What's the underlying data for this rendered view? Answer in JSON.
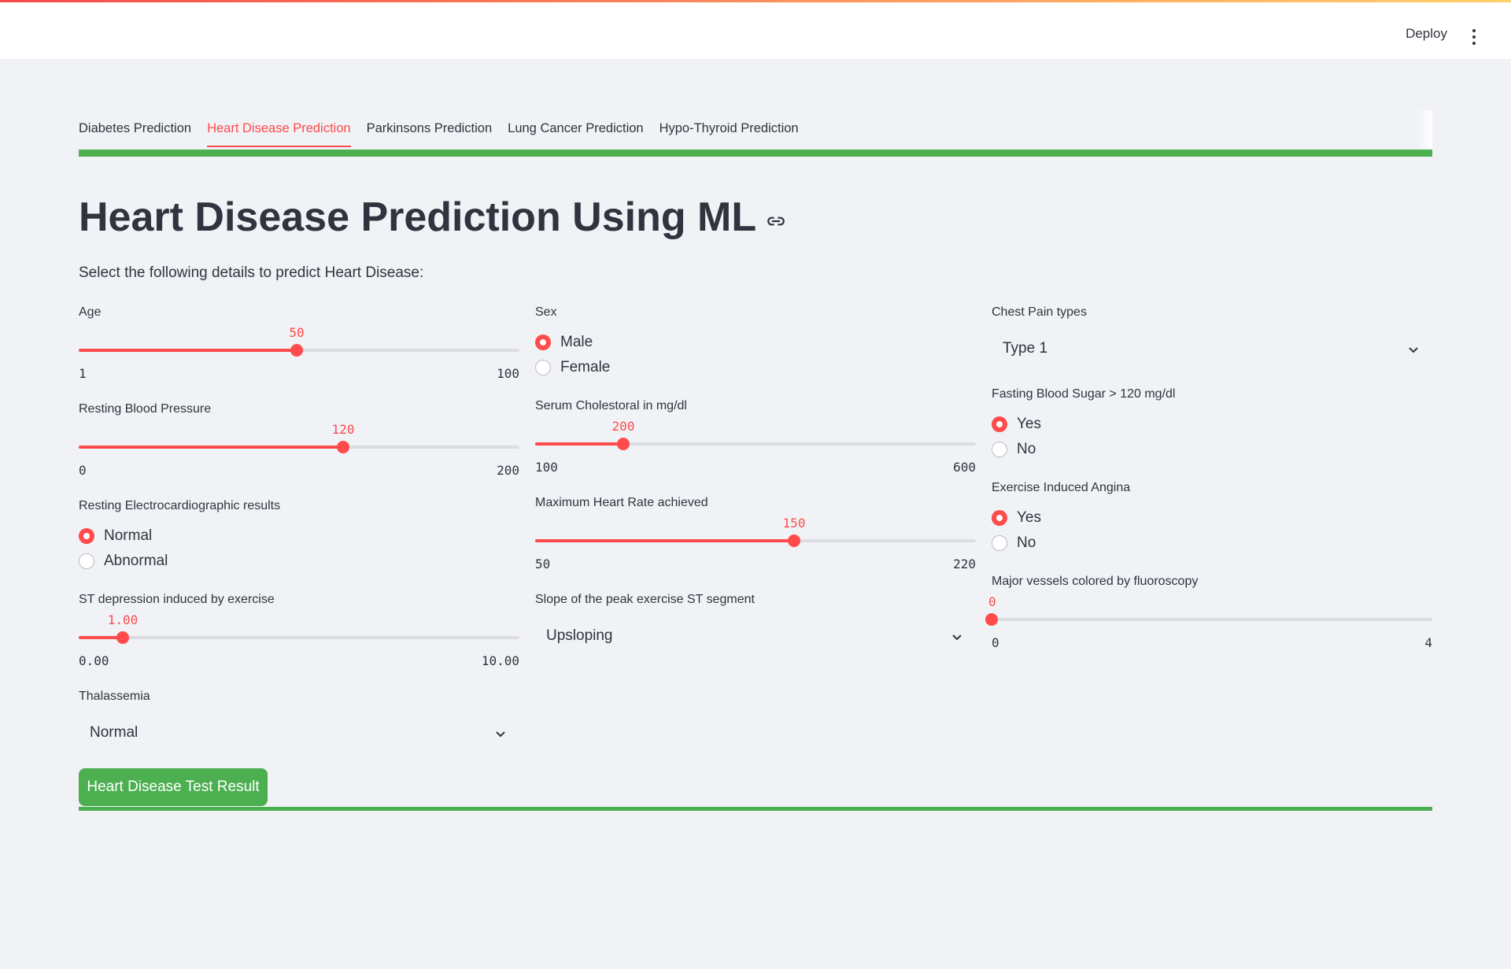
{
  "header": {
    "deploy_label": "Deploy"
  },
  "tabs": [
    {
      "label": "Diabetes Prediction"
    },
    {
      "label": "Heart Disease Prediction"
    },
    {
      "label": "Parkinsons Prediction"
    },
    {
      "label": "Lung Cancer Prediction"
    },
    {
      "label": "Hypo-Thyroid Prediction"
    }
  ],
  "active_tab": 1,
  "page": {
    "title": "Heart Disease Prediction Using ML",
    "subtitle": "Select the following details to predict Heart Disease:"
  },
  "fields": {
    "age": {
      "label": "Age",
      "value": "50",
      "min": "1",
      "max": "100",
      "fraction": 0.495
    },
    "sex": {
      "label": "Sex",
      "options": [
        "Male",
        "Female"
      ],
      "selected": 0
    },
    "chest_pain": {
      "label": "Chest Pain types",
      "value": "Type 1"
    },
    "resting_bp": {
      "label": "Resting Blood Pressure",
      "value": "120",
      "min": "0",
      "max": "200",
      "fraction": 0.6
    },
    "cholesterol": {
      "label": "Serum Cholestoral in mg/dl",
      "value": "200",
      "min": "100",
      "max": "600",
      "fraction": 0.2
    },
    "fbs": {
      "label": "Fasting Blood Sugar > 120 mg/dl",
      "options": [
        "Yes",
        "No"
      ],
      "selected": 0
    },
    "ecg": {
      "label": "Resting Electrocardiographic results",
      "options": [
        "Normal",
        "Abnormal"
      ],
      "selected": 0
    },
    "max_hr": {
      "label": "Maximum Heart Rate achieved",
      "value": "150",
      "min": "50",
      "max": "220",
      "fraction": 0.588
    },
    "angina": {
      "label": "Exercise Induced Angina",
      "options": [
        "Yes",
        "No"
      ],
      "selected": 0
    },
    "st_depression": {
      "label": "ST depression induced by exercise",
      "value": "1.00",
      "min": "0.00",
      "max": "10.00",
      "fraction": 0.1
    },
    "slope": {
      "label": "Slope of the peak exercise ST segment",
      "value": "Upsloping"
    },
    "vessels": {
      "label": "Major vessels colored by fluoroscopy",
      "value": "0",
      "min": "0",
      "max": "4",
      "fraction": 0.0
    },
    "thal": {
      "label": "Thalassemia",
      "value": "Normal"
    }
  },
  "submit": {
    "label": "Heart Disease Test Result"
  },
  "colors": {
    "accent": "#ff4b4b",
    "success": "#4caf50",
    "background": "#f0f2f6"
  },
  "icons": {
    "link": "link-icon",
    "chevron": "chevron-down-icon",
    "menu": "kebab-menu-icon"
  }
}
